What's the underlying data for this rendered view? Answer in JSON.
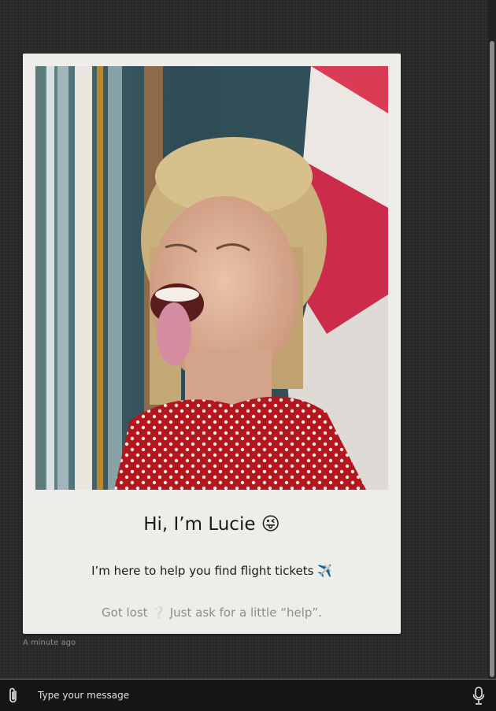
{
  "card": {
    "photo_alt": "Portrait of a woman with her tongue out",
    "title": "Hi, I’m Lucie 😜",
    "subtitle": "I’m here to help you find flight tickets ✈️",
    "hint": "Got lost ❔ Just ask for a little “help”."
  },
  "meta": {
    "timestamp": "A minute ago"
  },
  "composer": {
    "placeholder": "Type your message",
    "attach_icon": "paperclip-icon",
    "mic_icon": "microphone-icon"
  },
  "colors": {
    "background": "#2b2b2b",
    "card": "#efede9",
    "composer": "#151515",
    "hint_text": "#8c8c8c"
  }
}
